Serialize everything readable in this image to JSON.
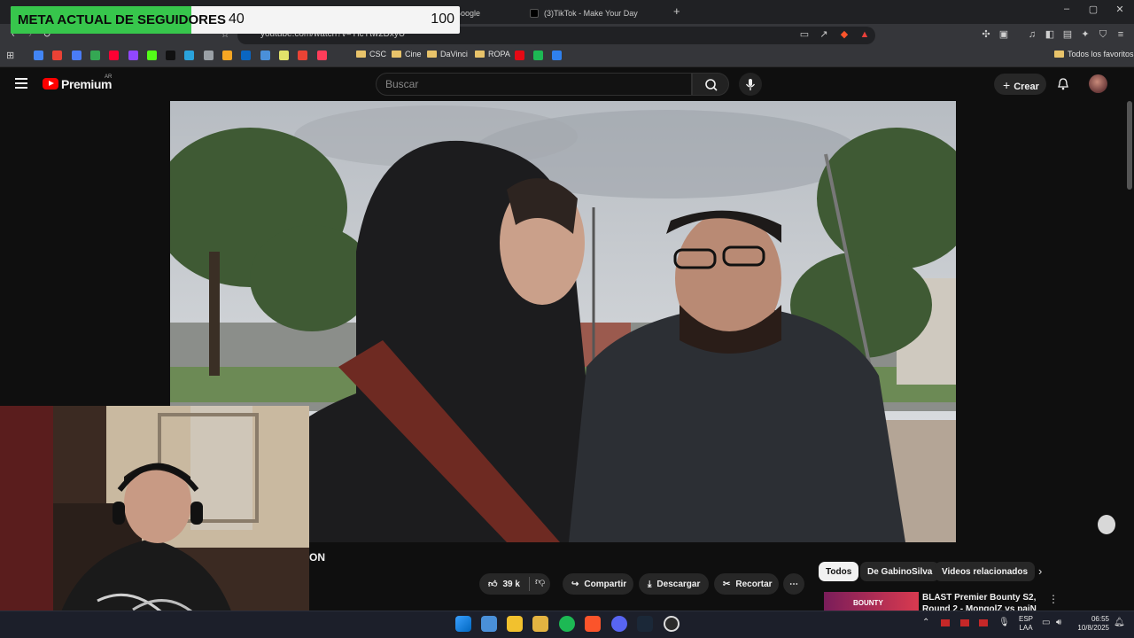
{
  "browser": {
    "tabs": [
      {
        "label": "Google"
      },
      {
        "label": "(3)TikTok - Make Your Day"
      }
    ],
    "new_tab_glyph": "+",
    "window_controls": [
      "–",
      "▢",
      "✕"
    ],
    "url": "youtube.com/watch?v=YlcYtw2DxyU",
    "bookmarks_folders": [
      "CSC",
      "Cine",
      "DaVinci",
      "ROPA"
    ],
    "all_bookmarks": "Todos los favoritos",
    "bookmark_icon_colors": [
      "#4285f4",
      "#e94235",
      "#4a7cf7",
      "#34a853",
      "#ff0033",
      "#9147ff",
      "#53fc18",
      "#111111",
      "#2aa3dc",
      "#9aa0a6",
      "#f6a623",
      "#0a66c2",
      "#4a90d9",
      "#e2e26a",
      "#ea4335",
      "#ff3d5a"
    ],
    "extra_icon_colors": [
      "#e50914",
      "#1db954",
      "#2f80ed"
    ]
  },
  "overlay": {
    "label": "META ACTUAL DE SEGUIDORES",
    "current": "40",
    "goal": "100",
    "progress": 0.4,
    "fill_color": "#37c64c"
  },
  "youtube": {
    "logo_text": "Premium",
    "region": "AR",
    "search_placeholder": "Buscar",
    "create_label": "Crear",
    "title_fragment": "ON",
    "likes": "39 k",
    "share_label": "Compartir",
    "download_label": "Descargar",
    "clip_label": "Recortar",
    "chips": [
      "Todos",
      "De GabinoSilva",
      "Videos relacionados"
    ],
    "rec_title_line1": "BLAST Premier Bounty S2,",
    "rec_title_line2": "Round 2 - MongolZ vs paiN",
    "rec_thumb_text": "BOUNTY"
  },
  "taskbar": {
    "lang_top": "ESP",
    "lang_bottom": "LAA",
    "time": "06:55",
    "date": "10/8/2025"
  },
  "colors": {
    "yt_red": "#ff0000",
    "accent_green": "#37c64c",
    "bg": "#0f0f0f"
  }
}
